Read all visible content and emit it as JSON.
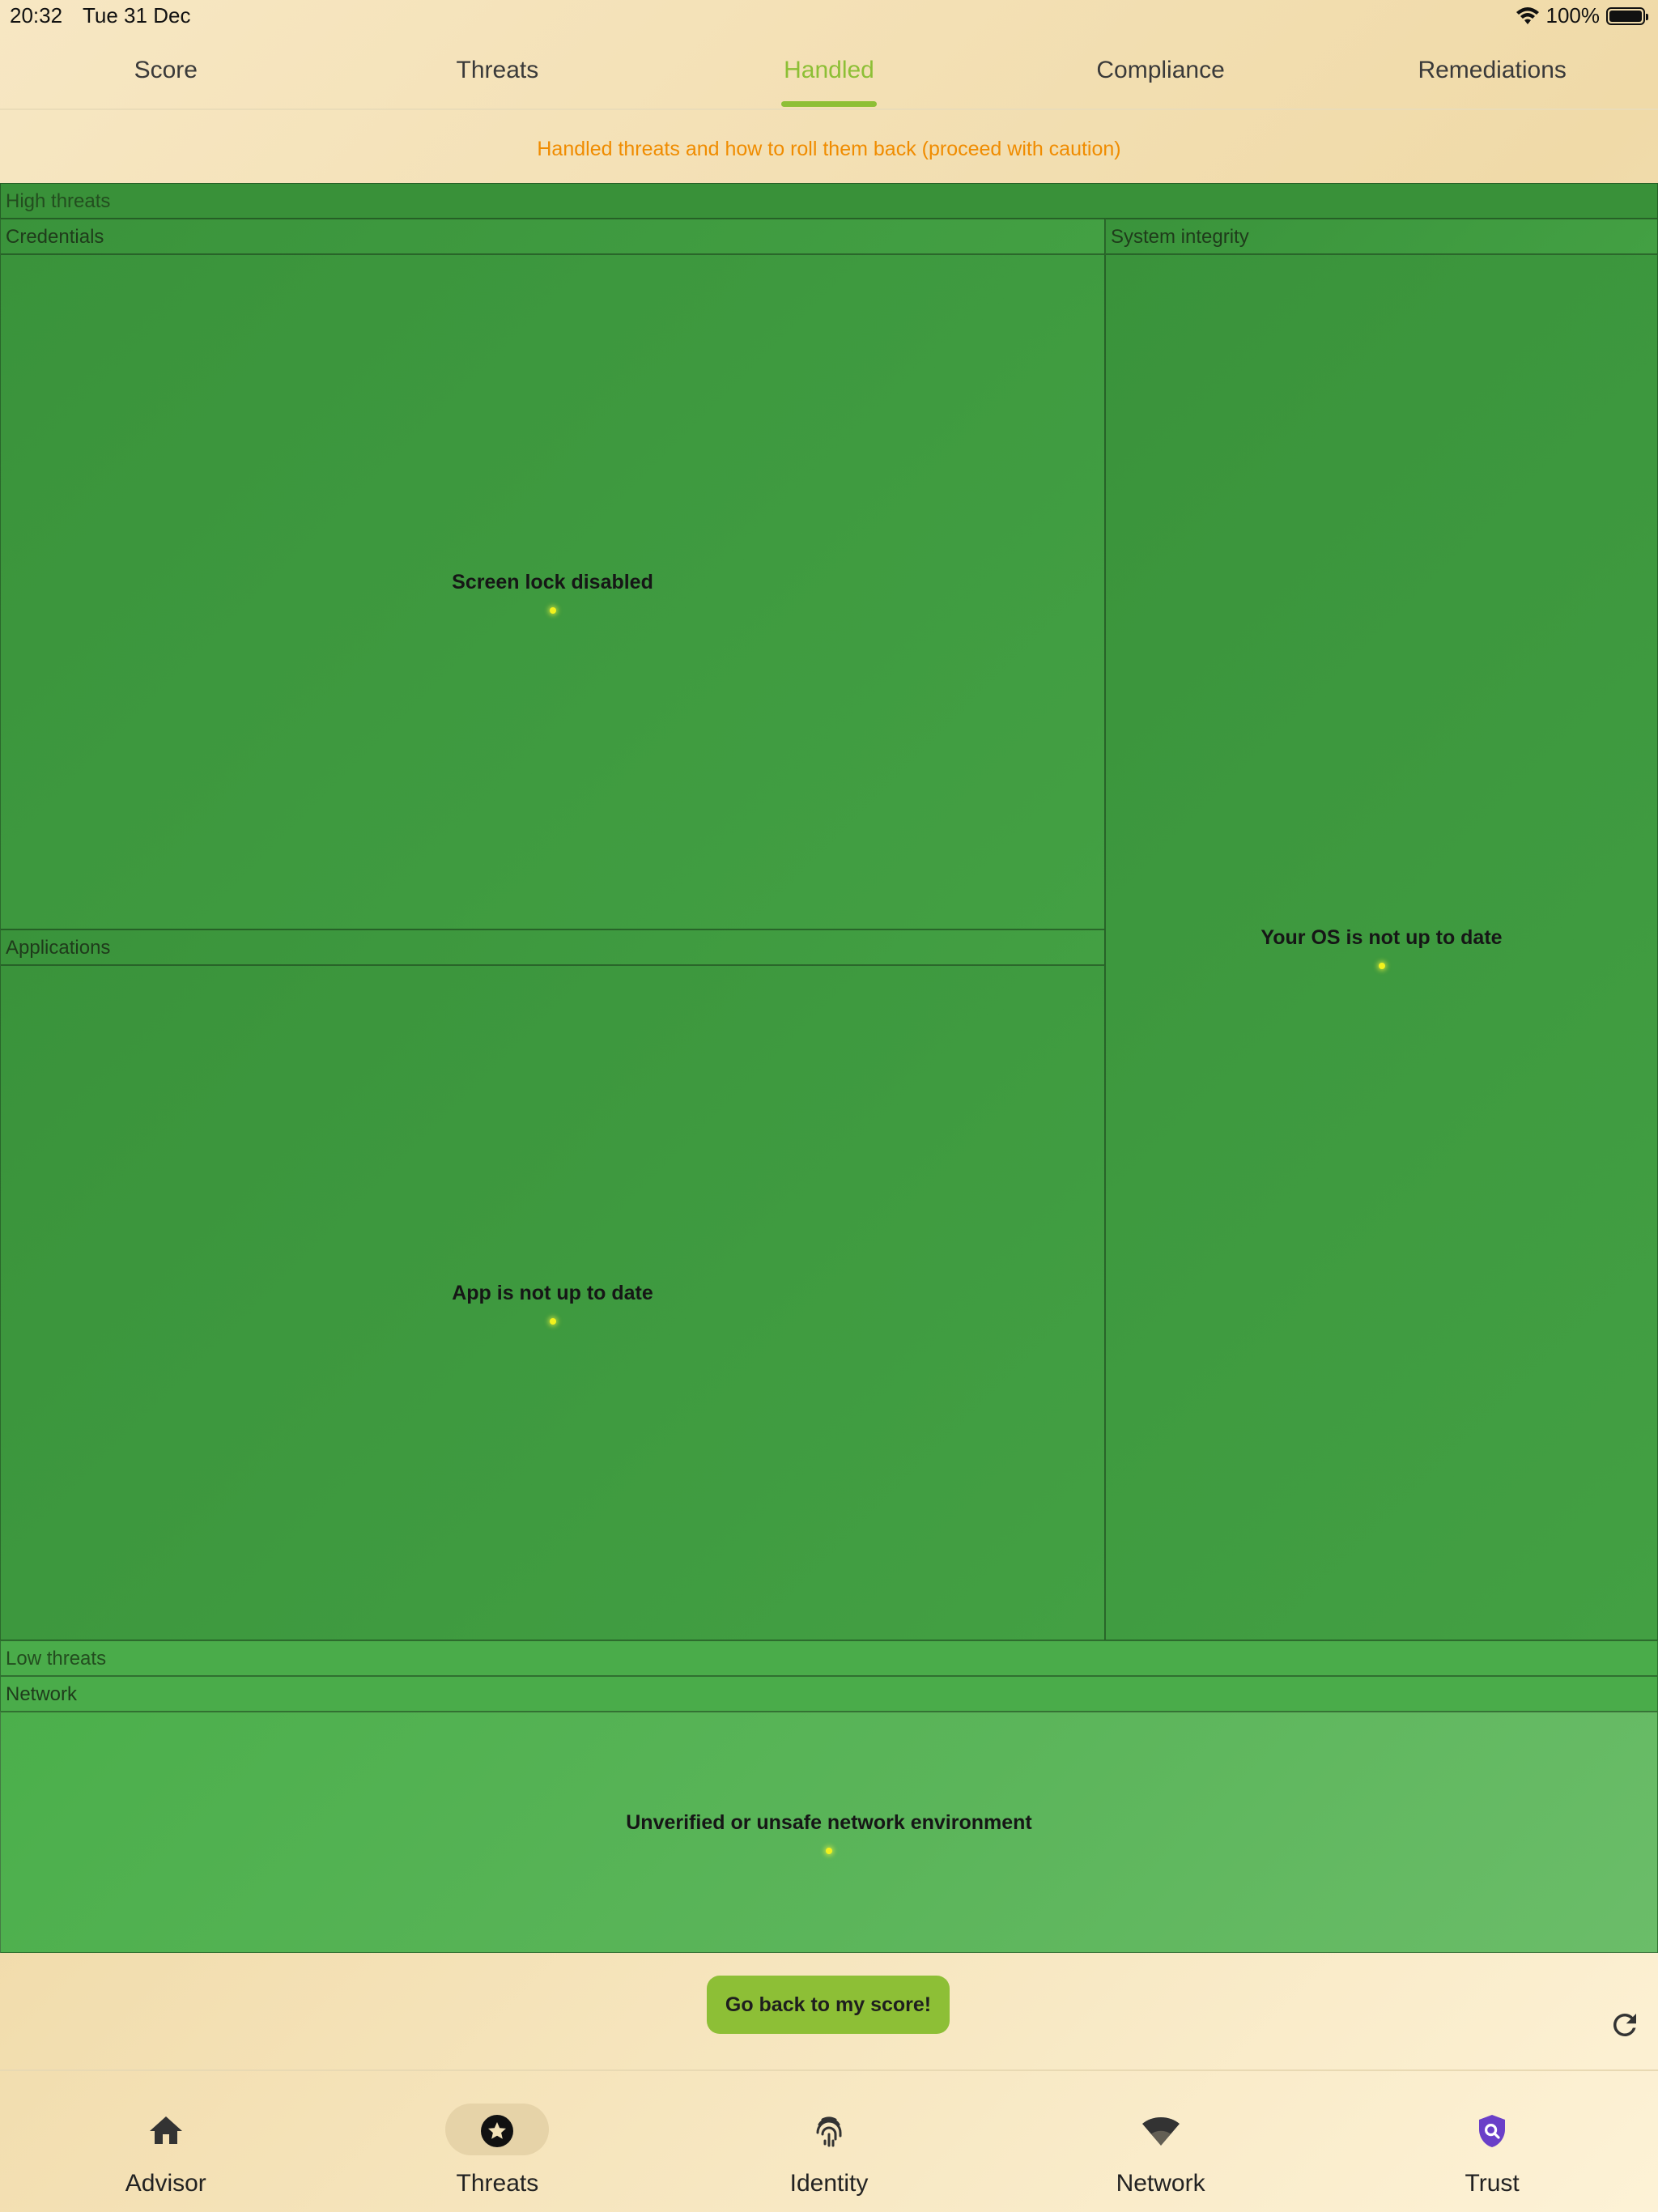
{
  "status_bar": {
    "time": "20:32",
    "date": "Tue 31 Dec",
    "battery": "100%"
  },
  "tabs": [
    {
      "label": "Score",
      "active": false
    },
    {
      "label": "Threats",
      "active": false
    },
    {
      "label": "Handled",
      "active": true
    },
    {
      "label": "Compliance",
      "active": false
    },
    {
      "label": "Remediations",
      "active": false
    }
  ],
  "subtitle": "Handled threats and how to roll them back (proceed with caution)",
  "treemap": {
    "high": {
      "title": "High threats",
      "categories": {
        "credentials": {
          "title": "Credentials",
          "item": "Screen lock disabled"
        },
        "applications": {
          "title": "Applications",
          "item": "App is not up to date"
        },
        "system_integrity": {
          "title": "System integrity",
          "item": "Your OS is not up to date"
        }
      }
    },
    "low": {
      "title": "Low threats",
      "categories": {
        "network": {
          "title": "Network",
          "item": "Unverified or unsafe network environment"
        }
      }
    }
  },
  "cta_label": "Go back to my score!",
  "bottom_nav": [
    {
      "label": "Advisor",
      "icon": "home-icon",
      "active": false
    },
    {
      "label": "Threats",
      "icon": "star-badge-icon",
      "active": true
    },
    {
      "label": "Identity",
      "icon": "fingerprint-icon",
      "active": false
    },
    {
      "label": "Network",
      "icon": "wifi-icon",
      "active": false
    },
    {
      "label": "Trust",
      "icon": "shield-search-icon",
      "active": false
    }
  ],
  "colors": {
    "accent": "#8dbf36",
    "subtitle": "#f08c00",
    "high_threat_fill": "#3f9b40",
    "low_threat_fill": "#5bb55a",
    "trust_icon": "#6a3fc8"
  }
}
